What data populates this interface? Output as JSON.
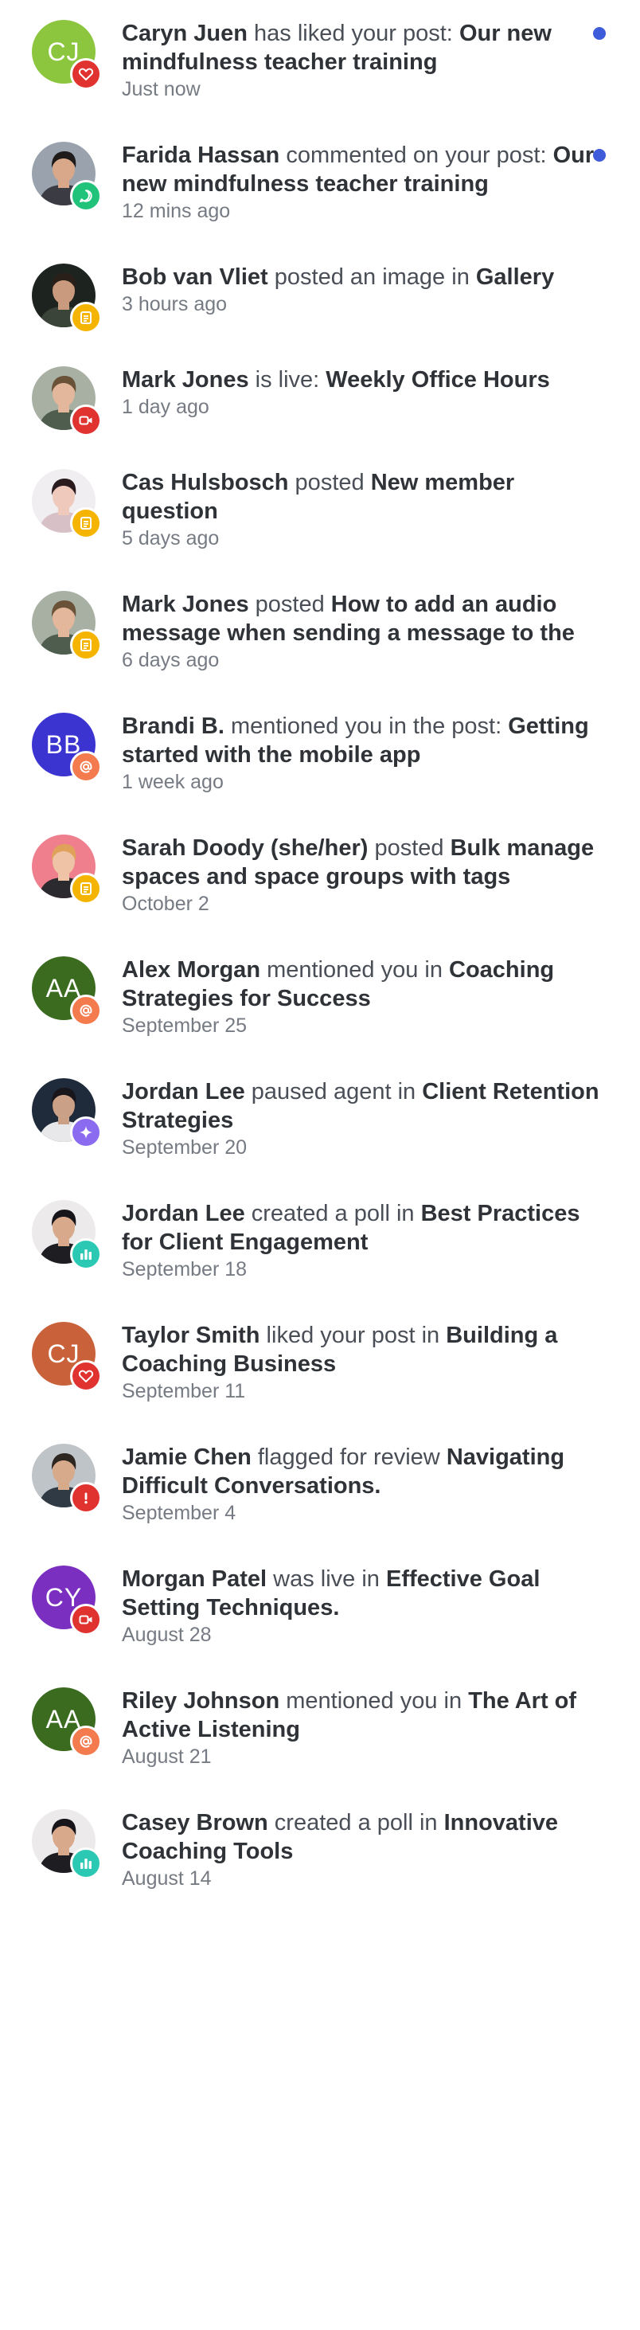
{
  "notifications": [
    {
      "actor": "Caryn Juen",
      "action": " has liked your post: ",
      "target": "Our new mindfulness teacher training",
      "time": "Just now",
      "unread": true,
      "avatar": {
        "type": "initials",
        "initials": "CJ",
        "color": "#8cc63f"
      },
      "badge": {
        "icon": "heart-icon",
        "color": "#e0322e"
      }
    },
    {
      "actor": "Farida Hassan",
      "action": " commented on your post: ",
      "target": "Our new mindfulness teacher training",
      "time": "12 mins ago",
      "unread": true,
      "avatar": {
        "type": "photo",
        "bg": "#9aa3ad",
        "skin": "#d9a88a",
        "hair": "#1f1b1b",
        "shirt": "#3b3b44"
      },
      "badge": {
        "icon": "comment-icon",
        "color": "#21c27a"
      }
    },
    {
      "actor": "Bob van Vliet",
      "action": " posted an image in ",
      "target": "Gallery",
      "time": "3 hours ago",
      "unread": false,
      "avatar": {
        "type": "photo",
        "bg": "#1d2420",
        "skin": "#c99a7d",
        "hair": "#2a2019",
        "shirt": "#3a4438"
      },
      "badge": {
        "icon": "post-icon",
        "color": "#f5b400"
      }
    },
    {
      "actor": "Mark Jones",
      "action": " is live: ",
      "target": "Weekly Office Hours",
      "time": "1 day ago",
      "unread": false,
      "avatar": {
        "type": "photo",
        "bg": "#a8b0a4",
        "skin": "#e2b79b",
        "hair": "#6a5239",
        "shirt": "#4f5d4f"
      },
      "badge": {
        "icon": "video-icon",
        "color": "#e0322e"
      }
    },
    {
      "actor": "Cas Hulsbosch",
      "action": " posted ",
      "target": "New member question",
      "time": "5 days ago",
      "unread": false,
      "avatar": {
        "type": "photo",
        "bg": "#f0eef0",
        "skin": "#efc9bb",
        "hair": "#2a1b1f",
        "shirt": "#d7c0c6"
      },
      "badge": {
        "icon": "post-icon",
        "color": "#f5b400"
      }
    },
    {
      "actor": "Mark Jones",
      "action": " posted ",
      "target": "How to add an audio message when sending a message to the",
      "time": "6 days ago",
      "unread": false,
      "avatar": {
        "type": "photo",
        "bg": "#a8b0a4",
        "skin": "#e2b79b",
        "hair": "#6a5239",
        "shirt": "#4f5d4f"
      },
      "badge": {
        "icon": "post-icon",
        "color": "#f5b400"
      }
    },
    {
      "actor": "Brandi B.",
      "action": " mentioned you in the post: ",
      "target": "Getting started with the mobile app",
      "time": "1 week ago",
      "unread": false,
      "avatar": {
        "type": "initials",
        "initials": "BB",
        "color": "#3b34d1"
      },
      "badge": {
        "icon": "mention-icon",
        "color": "#f37b4d"
      }
    },
    {
      "actor": "Sarah Doody (she/her)",
      "action": " posted ",
      "target": "Bulk manage spaces and space groups with tags",
      "time": "October 2",
      "unread": false,
      "avatar": {
        "type": "photo",
        "bg": "#f07f8e",
        "skin": "#efc4a6",
        "hair": "#e0a15a",
        "shirt": "#2b2b2f"
      },
      "badge": {
        "icon": "post-icon",
        "color": "#f5b400"
      }
    },
    {
      "actor": "Alex Morgan",
      "action": " mentioned you in ",
      "target": "Coaching Strategies for Success",
      "time": "September 25",
      "unread": false,
      "avatar": {
        "type": "initials",
        "initials": "AA",
        "color": "#3a6b1e"
      },
      "badge": {
        "icon": "mention-icon",
        "color": "#f37b4d"
      }
    },
    {
      "actor": "Jordan Lee",
      "action": " paused agent in ",
      "target": "Client Retention Strategies",
      "time": "September 20",
      "unread": false,
      "avatar": {
        "type": "photo",
        "bg": "#1f2a3a",
        "skin": "#caa086",
        "hair": "#18161a",
        "shirt": "#e8e8ea"
      },
      "badge": {
        "icon": "sparkle-icon",
        "color": "#8b6cf0"
      }
    },
    {
      "actor": "Jordan Lee",
      "action": " created a poll in ",
      "target": "Best Practices for Client Engagement",
      "time": "September 18",
      "unread": false,
      "avatar": {
        "type": "photo",
        "bg": "#eceaea",
        "skin": "#d9a98c",
        "hair": "#17151a",
        "shirt": "#1e1e22"
      },
      "badge": {
        "icon": "poll-icon",
        "color": "#2bc9b4"
      }
    },
    {
      "actor": "Taylor Smith",
      "action": " liked your post in ",
      "target": "Building a Coaching Business",
      "time": "September 11",
      "unread": false,
      "avatar": {
        "type": "initials",
        "initials": "CJ",
        "color": "#c9623a"
      },
      "badge": {
        "icon": "heart-icon",
        "color": "#e0322e"
      }
    },
    {
      "actor": "Jamie Chen",
      "action": " flagged for review ",
      "target": "Navigating Difficult Conversations.",
      "time": "September 4",
      "unread": false,
      "avatar": {
        "type": "photo",
        "bg": "#bfc4c9",
        "skin": "#d7aa8c",
        "hair": "#2e2620",
        "shirt": "#2f3a44"
      },
      "badge": {
        "icon": "alert-icon",
        "color": "#e0322e"
      }
    },
    {
      "actor": "Morgan Patel",
      "action": " was live in ",
      "target": "Effective Goal Setting Techniques.",
      "time": "August 28",
      "unread": false,
      "avatar": {
        "type": "initials",
        "initials": "CY",
        "color": "#7a2fc0"
      },
      "badge": {
        "icon": "video-icon",
        "color": "#e0322e"
      }
    },
    {
      "actor": "Riley Johnson",
      "action": " mentioned you in ",
      "target": "The Art of Active Listening",
      "time": "August 21",
      "unread": false,
      "avatar": {
        "type": "initials",
        "initials": "AA",
        "color": "#3a6b1e"
      },
      "badge": {
        "icon": "mention-icon",
        "color": "#f37b4d"
      }
    },
    {
      "actor": "Casey Brown",
      "action": " created a poll in ",
      "target": "Innovative Coaching Tools",
      "time": "August 14",
      "unread": false,
      "avatar": {
        "type": "photo",
        "bg": "#eceaea",
        "skin": "#d9a98c",
        "hair": "#17151a",
        "shirt": "#1e1e22"
      },
      "badge": {
        "icon": "poll-icon",
        "color": "#2bc9b4"
      }
    }
  ]
}
